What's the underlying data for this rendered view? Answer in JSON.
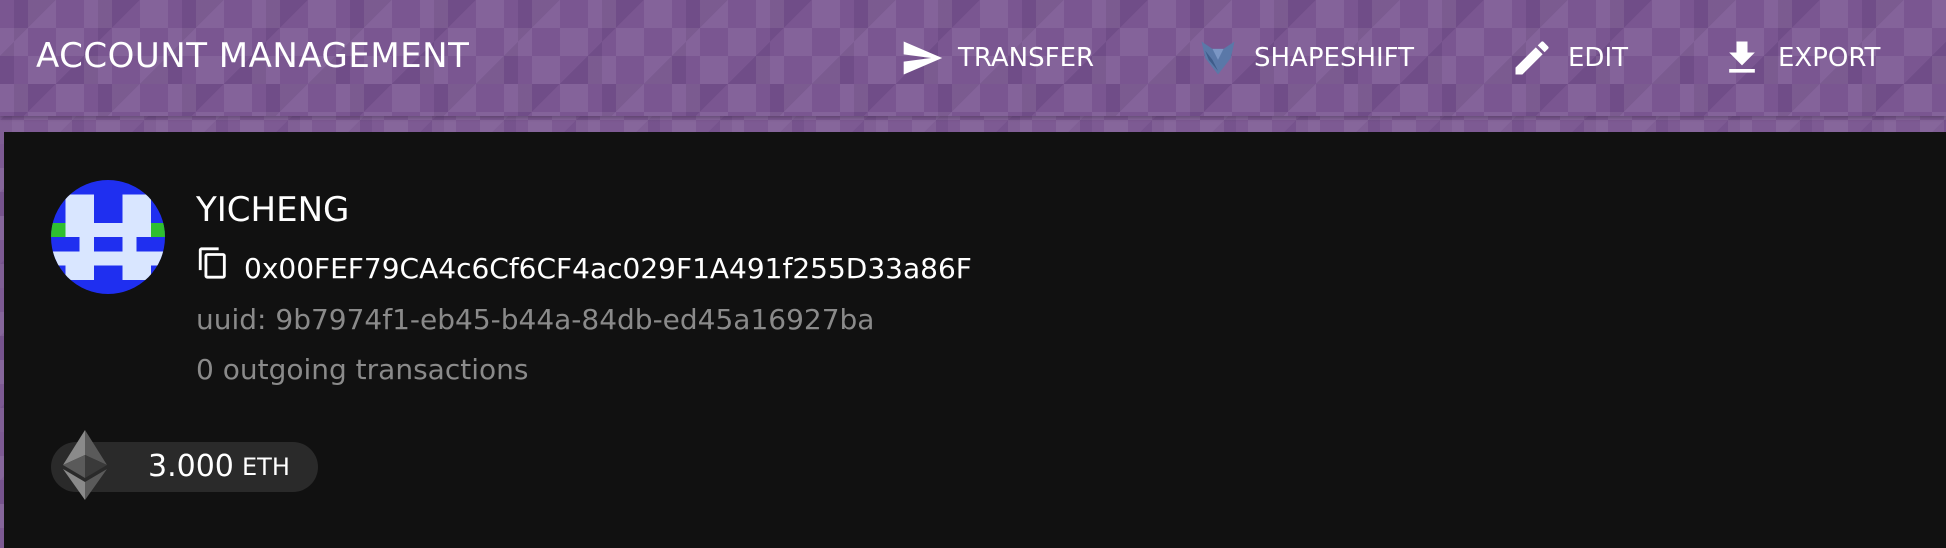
{
  "header": {
    "title": "ACCOUNT MANAGEMENT",
    "actions": [
      {
        "label": "TRANSFER",
        "icon": "send-icon"
      },
      {
        "label": "SHAPESHIFT",
        "icon": "shapeshift-fox-icon"
      },
      {
        "label": "EDIT",
        "icon": "pencil-icon"
      },
      {
        "label": "EXPORT",
        "icon": "download-icon"
      }
    ]
  },
  "account": {
    "name": "YICHENG",
    "address": "0x00FEF79CA4c6Cf6CF4ac029F1A491f255D33a86F",
    "uuid": "uuid: 9b7974f1-eb45-b44a-84db-ed45a16927ba",
    "transactions": "0 outgoing transactions",
    "identicon_colors": [
      "#1f2ff0",
      "#d9e6ff",
      "#2fbf2f"
    ]
  },
  "balance": {
    "value": "3.000",
    "unit": "ETH",
    "icon": "ethereum-icon"
  },
  "colors": {
    "header_bg": "#7a5691",
    "panel_bg": "#111111",
    "muted_text": "#8a8a8a",
    "chip_bg": "#2a2a2a"
  }
}
